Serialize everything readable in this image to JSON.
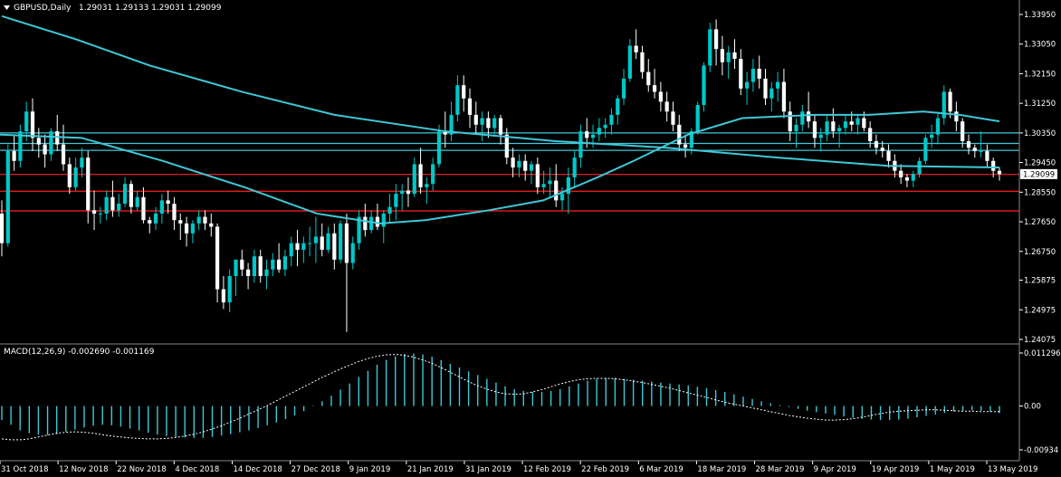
{
  "header": {
    "symbol_label": "GBPUSD,Daily",
    "ohlc": "1.29031 1.29133 1.29031 1.29099"
  },
  "macd": {
    "label": "MACD(12,26,9) -0.002690 -0.001169"
  },
  "price_axis": {
    "ticks": [
      "1.33950",
      "1.33050",
      "1.32150",
      "1.31250",
      "1.30350",
      "1.29450",
      "1.28550",
      "1.27650",
      "1.26750",
      "1.25875",
      "1.24975",
      "1.24075"
    ],
    "current_price": "1.29099"
  },
  "macd_axis": {
    "ticks": [
      "0.011296",
      "0.00",
      "-0.00934"
    ]
  },
  "time_axis": {
    "labels": [
      "31 Oct 2018",
      "12 Nov 2018",
      "22 Nov 2018",
      "4 Dec 2018",
      "14 Dec 2018",
      "27 Dec 2018",
      "9 Jan 2019",
      "21 Jan 2019",
      "31 Jan 2019",
      "12 Feb 2019",
      "22 Feb 2019",
      "6 Mar 2019",
      "18 Mar 2019",
      "28 Mar 2019",
      "9 Apr 2019",
      "19 Apr 2019",
      "1 May 2019",
      "13 May 2019"
    ]
  },
  "colors": {
    "background": "#000000",
    "bull_candle": "#00c8c8",
    "bear_candle": "#ffffff",
    "moving_average": "#3fc8d8",
    "support_resistance_red": "#ff2020",
    "horizontal_cyan": "#3fc8d8",
    "macd_histogram": "#3fc8d8",
    "macd_signal": "#ffffff",
    "separator": "#8a8a8a"
  },
  "chart_data": {
    "type": "candlestick",
    "symbol": "GBPUSD",
    "timeframe": "Daily",
    "y_range": [
      1.24075,
      1.3395
    ],
    "red_levels": [
      1.2909,
      1.2858,
      1.2798
    ],
    "cyan_levels": [
      1.3035,
      1.3003,
      1.2982
    ],
    "candles": [
      [
        1.279,
        1.283,
        1.266,
        1.27
      ],
      [
        1.27,
        1.3,
        1.269,
        1.298
      ],
      [
        1.298,
        1.303,
        1.292,
        1.295
      ],
      [
        1.295,
        1.306,
        1.293,
        1.304
      ],
      [
        1.304,
        1.313,
        1.301,
        1.31
      ],
      [
        1.31,
        1.314,
        1.298,
        1.302
      ],
      [
        1.302,
        1.305,
        1.296,
        1.3
      ],
      [
        1.3,
        1.303,
        1.293,
        1.297
      ],
      [
        1.297,
        1.305,
        1.295,
        1.304
      ],
      [
        1.304,
        1.309,
        1.298,
        1.3
      ],
      [
        1.3,
        1.306,
        1.292,
        1.294
      ],
      [
        1.294,
        1.296,
        1.285,
        1.287
      ],
      [
        1.287,
        1.296,
        1.286,
        1.293
      ],
      [
        1.293,
        1.299,
        1.29,
        1.296
      ],
      [
        1.296,
        1.298,
        1.276,
        1.28
      ],
      [
        1.28,
        1.286,
        1.274,
        1.279
      ],
      [
        1.279,
        1.281,
        1.276,
        1.279
      ],
      [
        1.279,
        1.286,
        1.277,
        1.284
      ],
      [
        1.284,
        1.289,
        1.278,
        1.28
      ],
      [
        1.28,
        1.285,
        1.278,
        1.282
      ],
      [
        1.282,
        1.29,
        1.281,
        1.288
      ],
      [
        1.288,
        1.289,
        1.279,
        1.281
      ],
      [
        1.281,
        1.286,
        1.28,
        1.284
      ],
      [
        1.284,
        1.287,
        1.276,
        1.277
      ],
      [
        1.277,
        1.278,
        1.273,
        1.276
      ],
      [
        1.276,
        1.281,
        1.274,
        1.279
      ],
      [
        1.279,
        1.285,
        1.276,
        1.283
      ],
      [
        1.283,
        1.286,
        1.279,
        1.282
      ],
      [
        1.282,
        1.284,
        1.274,
        1.277
      ],
      [
        1.277,
        1.279,
        1.271,
        1.276
      ],
      [
        1.276,
        1.278,
        1.269,
        1.273
      ],
      [
        1.273,
        1.277,
        1.27,
        1.276
      ],
      [
        1.276,
        1.28,
        1.274,
        1.278
      ],
      [
        1.278,
        1.28,
        1.274,
        1.276
      ],
      [
        1.276,
        1.279,
        1.272,
        1.275
      ],
      [
        1.275,
        1.276,
        1.252,
        1.256
      ],
      [
        1.256,
        1.26,
        1.25,
        1.252
      ],
      [
        1.252,
        1.262,
        1.249,
        1.26
      ],
      [
        1.26,
        1.265,
        1.254,
        1.265
      ],
      [
        1.265,
        1.268,
        1.26,
        1.262
      ],
      [
        1.262,
        1.264,
        1.256,
        1.26
      ],
      [
        1.26,
        1.268,
        1.258,
        1.266
      ],
      [
        1.266,
        1.268,
        1.258,
        1.26
      ],
      [
        1.26,
        1.265,
        1.256,
        1.262
      ],
      [
        1.262,
        1.267,
        1.26,
        1.265
      ],
      [
        1.265,
        1.27,
        1.261,
        1.262
      ],
      [
        1.262,
        1.268,
        1.26,
        1.266
      ],
      [
        1.266,
        1.272,
        1.263,
        1.27
      ],
      [
        1.27,
        1.274,
        1.263,
        1.268
      ],
      [
        1.268,
        1.272,
        1.264,
        1.27
      ],
      [
        1.27,
        1.275,
        1.266,
        1.27
      ],
      [
        1.27,
        1.278,
        1.264,
        1.272
      ],
      [
        1.272,
        1.276,
        1.266,
        1.268
      ],
      [
        1.268,
        1.275,
        1.267,
        1.273
      ],
      [
        1.273,
        1.276,
        1.262,
        1.265
      ],
      [
        1.265,
        1.277,
        1.264,
        1.276
      ],
      [
        1.276,
        1.279,
        1.243,
        1.264
      ],
      [
        1.264,
        1.272,
        1.262,
        1.27
      ],
      [
        1.27,
        1.28,
        1.268,
        1.278
      ],
      [
        1.278,
        1.282,
        1.272,
        1.274
      ],
      [
        1.274,
        1.28,
        1.273,
        1.278
      ],
      [
        1.278,
        1.282,
        1.274,
        1.275
      ],
      [
        1.275,
        1.28,
        1.27,
        1.279
      ],
      [
        1.279,
        1.285,
        1.276,
        1.281
      ],
      [
        1.281,
        1.288,
        1.277,
        1.285
      ],
      [
        1.285,
        1.288,
        1.28,
        1.286
      ],
      [
        1.286,
        1.29,
        1.281,
        1.285
      ],
      [
        1.285,
        1.296,
        1.284,
        1.294
      ],
      [
        1.294,
        1.299,
        1.285,
        1.287
      ],
      [
        1.287,
        1.29,
        1.282,
        1.288
      ],
      [
        1.288,
        1.296,
        1.286,
        1.294
      ],
      [
        1.294,
        1.306,
        1.293,
        1.304
      ],
      [
        1.304,
        1.31,
        1.299,
        1.303
      ],
      [
        1.303,
        1.313,
        1.301,
        1.309
      ],
      [
        1.309,
        1.321,
        1.307,
        1.318
      ],
      [
        1.318,
        1.321,
        1.31,
        1.314
      ],
      [
        1.314,
        1.317,
        1.305,
        1.309
      ],
      [
        1.309,
        1.313,
        1.303,
        1.306
      ],
      [
        1.306,
        1.31,
        1.301,
        1.308
      ],
      [
        1.308,
        1.31,
        1.302,
        1.305
      ],
      [
        1.305,
        1.309,
        1.303,
        1.308
      ],
      [
        1.308,
        1.309,
        1.3,
        1.303
      ],
      [
        1.303,
        1.305,
        1.294,
        1.296
      ],
      [
        1.296,
        1.299,
        1.29,
        1.293
      ],
      [
        1.293,
        1.297,
        1.29,
        1.295
      ],
      [
        1.295,
        1.297,
        1.289,
        1.292
      ],
      [
        1.292,
        1.295,
        1.288,
        1.294
      ],
      [
        1.294,
        1.296,
        1.285,
        1.287
      ],
      [
        1.287,
        1.292,
        1.285,
        1.288
      ],
      [
        1.288,
        1.293,
        1.284,
        1.289
      ],
      [
        1.289,
        1.294,
        1.281,
        1.283
      ],
      [
        1.283,
        1.287,
        1.28,
        1.285
      ],
      [
        1.285,
        1.293,
        1.279,
        1.29
      ],
      [
        1.29,
        1.298,
        1.287,
        1.296
      ],
      [
        1.296,
        1.306,
        1.293,
        1.304
      ],
      [
        1.304,
        1.308,
        1.299,
        1.302
      ],
      [
        1.302,
        1.306,
        1.299,
        1.303
      ],
      [
        1.303,
        1.308,
        1.301,
        1.305
      ],
      [
        1.305,
        1.308,
        1.302,
        1.306
      ],
      [
        1.306,
        1.311,
        1.303,
        1.309
      ],
      [
        1.309,
        1.315,
        1.306,
        1.314
      ],
      [
        1.314,
        1.323,
        1.312,
        1.32
      ],
      [
        1.32,
        1.332,
        1.319,
        1.33
      ],
      [
        1.33,
        1.335,
        1.326,
        1.328
      ],
      [
        1.328,
        1.33,
        1.32,
        1.322
      ],
      [
        1.322,
        1.326,
        1.316,
        1.318
      ],
      [
        1.318,
        1.323,
        1.314,
        1.316
      ],
      [
        1.316,
        1.319,
        1.31,
        1.313
      ],
      [
        1.313,
        1.316,
        1.307,
        1.31
      ],
      [
        1.31,
        1.313,
        1.304,
        1.306
      ],
      [
        1.306,
        1.309,
        1.298,
        1.3
      ],
      [
        1.3,
        1.303,
        1.296,
        1.299
      ],
      [
        1.299,
        1.305,
        1.297,
        1.304
      ],
      [
        1.304,
        1.313,
        1.303,
        1.312
      ],
      [
        1.312,
        1.325,
        1.31,
        1.324
      ],
      [
        1.324,
        1.337,
        1.322,
        1.335
      ],
      [
        1.335,
        1.338,
        1.324,
        1.329
      ],
      [
        1.329,
        1.333,
        1.321,
        1.325
      ],
      [
        1.325,
        1.33,
        1.32,
        1.328
      ],
      [
        1.328,
        1.332,
        1.323,
        1.326
      ],
      [
        1.326,
        1.329,
        1.315,
        1.317
      ],
      [
        1.317,
        1.322,
        1.312,
        1.319
      ],
      [
        1.319,
        1.326,
        1.316,
        1.323
      ],
      [
        1.323,
        1.327,
        1.317,
        1.32
      ],
      [
        1.32,
        1.323,
        1.312,
        1.314
      ],
      [
        1.314,
        1.319,
        1.31,
        1.317
      ],
      [
        1.317,
        1.322,
        1.313,
        1.319
      ],
      [
        1.319,
        1.323,
        1.308,
        1.31
      ],
      [
        1.31,
        1.313,
        1.301,
        1.304
      ],
      [
        1.304,
        1.308,
        1.299,
        1.306
      ],
      [
        1.306,
        1.312,
        1.304,
        1.31
      ],
      [
        1.31,
        1.316,
        1.305,
        1.307
      ],
      [
        1.307,
        1.309,
        1.299,
        1.302
      ],
      [
        1.302,
        1.305,
        1.298,
        1.303
      ],
      [
        1.303,
        1.309,
        1.301,
        1.307
      ],
      [
        1.307,
        1.311,
        1.302,
        1.304
      ],
      [
        1.304,
        1.306,
        1.299,
        1.305
      ],
      [
        1.305,
        1.309,
        1.303,
        1.307
      ],
      [
        1.307,
        1.31,
        1.304,
        1.306
      ],
      [
        1.306,
        1.309,
        1.303,
        1.308
      ],
      [
        1.308,
        1.31,
        1.304,
        1.305
      ],
      [
        1.305,
        1.307,
        1.299,
        1.301
      ],
      [
        1.301,
        1.303,
        1.297,
        1.299
      ],
      [
        1.299,
        1.301,
        1.296,
        1.298
      ],
      [
        1.298,
        1.3,
        1.293,
        1.295
      ],
      [
        1.295,
        1.297,
        1.29,
        1.292
      ],
      [
        1.292,
        1.294,
        1.288,
        1.29
      ],
      [
        1.29,
        1.291,
        1.287,
        1.289
      ],
      [
        1.289,
        1.292,
        1.287,
        1.291
      ],
      [
        1.291,
        1.296,
        1.29,
        1.295
      ],
      [
        1.295,
        1.303,
        1.294,
        1.302
      ],
      [
        1.302,
        1.306,
        1.299,
        1.303
      ],
      [
        1.303,
        1.31,
        1.3,
        1.308
      ],
      [
        1.308,
        1.318,
        1.306,
        1.316
      ],
      [
        1.316,
        1.317,
        1.308,
        1.31
      ],
      [
        1.31,
        1.313,
        1.304,
        1.307
      ],
      [
        1.307,
        1.308,
        1.299,
        1.301
      ],
      [
        1.301,
        1.303,
        1.297,
        1.299
      ],
      [
        1.299,
        1.3,
        1.296,
        1.298
      ],
      [
        1.298,
        1.304,
        1.296,
        1.298
      ],
      [
        1.298,
        1.3,
        1.293,
        1.295
      ],
      [
        1.295,
        1.296,
        1.29,
        1.292
      ],
      [
        1.292,
        1.293,
        1.289,
        1.291
      ]
    ],
    "ma_slow": [
      [
        0,
        1.339
      ],
      [
        40,
        1.332
      ],
      [
        80,
        1.324
      ],
      [
        130,
        1.316
      ],
      [
        180,
        1.309
      ],
      [
        240,
        1.304
      ],
      [
        300,
        1.301
      ],
      [
        360,
        1.299
      ],
      [
        420,
        1.296
      ],
      [
        480,
        1.2935
      ],
      [
        540,
        1.293
      ]
    ],
    "ma_fast": [
      [
        0,
        1.303
      ],
      [
        90,
        1.302
      ],
      [
        180,
        1.295
      ],
      [
        270,
        1.287
      ],
      [
        350,
        1.279
      ],
      [
        420,
        1.276
      ],
      [
        470,
        1.277
      ],
      [
        540,
        1.28
      ],
      [
        600,
        1.283
      ],
      [
        660,
        1.29
      ],
      [
        700,
        1.295
      ],
      [
        760,
        1.303
      ],
      [
        820,
        1.308
      ],
      [
        900,
        1.309
      ],
      [
        960,
        1.309
      ],
      [
        1020,
        1.31
      ],
      [
        1060,
        1.309
      ],
      [
        1104,
        1.307
      ]
    ],
    "macd_hist": [
      -0.003,
      -0.004,
      -0.0052,
      -0.0058,
      -0.0061,
      -0.0062,
      -0.006,
      -0.0055,
      -0.005,
      -0.0046,
      -0.0042,
      -0.004,
      -0.0041,
      -0.0044,
      -0.0048,
      -0.0052,
      -0.0057,
      -0.0061,
      -0.0064,
      -0.0066,
      -0.0067,
      -0.0068,
      -0.0068,
      -0.0066,
      -0.0063,
      -0.006,
      -0.0056,
      -0.0052,
      -0.0047,
      -0.0041,
      -0.0035,
      -0.0028,
      -0.002,
      -0.0011,
      -0.0001,
      0.001,
      0.0022,
      0.0035,
      0.0048,
      0.0062,
      0.0075,
      0.0088,
      0.0098,
      0.0106,
      0.0111,
      0.0112,
      0.011,
      0.0105,
      0.0098,
      0.009,
      0.0082,
      0.0074,
      0.0066,
      0.0058,
      0.005,
      0.0042,
      0.0036,
      0.0032,
      0.003,
      0.003,
      0.0032,
      0.0036,
      0.0042,
      0.0048,
      0.0054,
      0.0058,
      0.006,
      0.006,
      0.0058,
      0.0056,
      0.0054,
      0.0052,
      0.005,
      0.0048,
      0.0046,
      0.0044,
      0.0041,
      0.0038,
      0.0034,
      0.003,
      0.0025,
      0.002,
      0.0015,
      0.001,
      0.0006,
      0.0002,
      -0.0002,
      -0.0006,
      -0.001,
      -0.0013,
      -0.0016,
      -0.0019,
      -0.0022,
      -0.0025,
      -0.0027,
      -0.0029,
      -0.003,
      -0.003,
      -0.0029,
      -0.0027,
      -0.0024,
      -0.0021,
      -0.0018,
      -0.0015,
      -0.0012,
      -0.001,
      -0.0009,
      -0.001,
      -0.0012,
      -0.0015
    ],
    "macd_signal": [
      -0.007,
      -0.0072,
      -0.0072,
      -0.007,
      -0.0066,
      -0.0062,
      -0.0058,
      -0.0056,
      -0.0055,
      -0.0056,
      -0.0058,
      -0.0061,
      -0.0064,
      -0.0066,
      -0.0068,
      -0.0069,
      -0.007,
      -0.007,
      -0.0069,
      -0.0067,
      -0.0064,
      -0.006,
      -0.0055,
      -0.0049,
      -0.0042,
      -0.0034,
      -0.0026,
      -0.0017,
      -0.0008,
      0.0001,
      0.0011,
      0.0021,
      0.0031,
      0.0041,
      0.0051,
      0.0061,
      0.007,
      0.0079,
      0.0087,
      0.0095,
      0.0101,
      0.0106,
      0.0109,
      0.011,
      0.0108,
      0.0104,
      0.0098,
      0.0091,
      0.0082,
      0.0072,
      0.0062,
      0.0052,
      0.0043,
      0.0036,
      0.003,
      0.0026,
      0.0025,
      0.0026,
      0.003,
      0.0035,
      0.0041,
      0.0047,
      0.0052,
      0.0056,
      0.0058,
      0.0059,
      0.0059,
      0.0058,
      0.0056,
      0.0053,
      0.005,
      0.0046,
      0.0042,
      0.0038,
      0.0033,
      0.0028,
      0.0023,
      0.0018,
      0.0013,
      0.0008,
      0.0004,
      0.0,
      -0.0004,
      -0.0008,
      -0.0012,
      -0.0016,
      -0.002,
      -0.0023,
      -0.0026,
      -0.0028,
      -0.003,
      -0.003,
      -0.0029,
      -0.0027,
      -0.0024,
      -0.002,
      -0.0016,
      -0.0013,
      -0.0011,
      -0.001,
      -0.0009,
      -0.0008,
      -0.0008,
      -0.0009,
      -0.001,
      -0.0011,
      -0.0011,
      -0.0012,
      -0.0012,
      -0.0012
    ]
  }
}
